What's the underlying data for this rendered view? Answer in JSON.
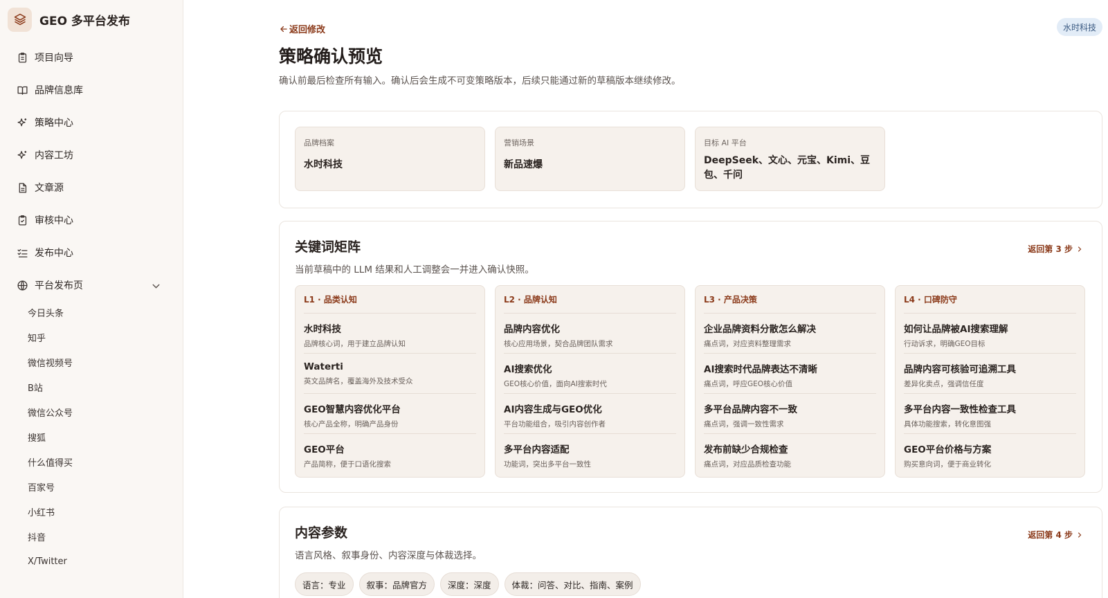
{
  "app": {
    "title": "GEO 多平台发布"
  },
  "nav": {
    "items": [
      {
        "label": "项目向导",
        "icon": "clipboard-icon"
      },
      {
        "label": "品牌信息库",
        "icon": "book-open-icon"
      },
      {
        "label": "策略中心",
        "icon": "sparkles-icon"
      },
      {
        "label": "内容工坊",
        "icon": "sparkles-icon"
      },
      {
        "label": "文章源",
        "icon": "document-icon"
      },
      {
        "label": "审核中心",
        "icon": "clipboard-check-icon"
      },
      {
        "label": "发布中心",
        "icon": "list-check-icon"
      },
      {
        "label": "平台发布页",
        "icon": "globe-icon"
      }
    ],
    "platforms": [
      "今日头条",
      "知乎",
      "微信视频号",
      "B站",
      "微信公众号",
      "搜狐",
      "什么值得买",
      "百家号",
      "小红书",
      "抖音",
      "X/Twitter"
    ]
  },
  "header": {
    "back_label": "返回修改",
    "user_badge": "水时科技",
    "title": "策略确认预览",
    "description": "确认前最后检查所有输入。确认后会生成不可变策略版本，后续只能通过新的草稿版本继续修改。"
  },
  "summary": [
    {
      "label": "品牌档案",
      "value": "水时科技"
    },
    {
      "label": "营销场景",
      "value": "新品速爆"
    },
    {
      "label": "目标 AI 平台",
      "value": "DeepSeek、文心、元宝、Kimi、豆包、千问"
    }
  ],
  "keywords": {
    "title": "关键词矩阵",
    "description": "当前草稿中的 LLM 结果和人工调整会一并进入确认快照。",
    "back_link": "返回第 3 步",
    "columns": [
      {
        "heading": "L1 · 品类认知",
        "items": [
          {
            "name": "水时科技",
            "note": "品牌核心词，用于建立品牌认知"
          },
          {
            "name": "Waterti",
            "note": "英文品牌名，覆盖海外及技术受众"
          },
          {
            "name": "GEO智慧内容优化平台",
            "note": "核心产品全称，明确产品身份"
          },
          {
            "name": "GEO平台",
            "note": "产品简称，便于口语化搜索"
          }
        ]
      },
      {
        "heading": "L2 · 品牌认知",
        "items": [
          {
            "name": "品牌内容优化",
            "note": "核心应用场景，契合品牌团队需求"
          },
          {
            "name": "AI搜索优化",
            "note": "GEO核心价值，面向AI搜索时代"
          },
          {
            "name": "AI内容生成与GEO优化",
            "note": "平台功能组合，吸引内容创作者"
          },
          {
            "name": "多平台内容适配",
            "note": "功能词，突出多平台一致性"
          }
        ]
      },
      {
        "heading": "L3 · 产品决策",
        "items": [
          {
            "name": "企业品牌资料分散怎么解决",
            "note": "痛点词，对应资料整理需求"
          },
          {
            "name": "AI搜索时代品牌表达不清晰",
            "note": "痛点词，呼应GEO核心价值"
          },
          {
            "name": "多平台品牌内容不一致",
            "note": "痛点词，强调一致性需求"
          },
          {
            "name": "发布前缺少合规检查",
            "note": "痛点词，对应品质检查功能"
          }
        ]
      },
      {
        "heading": "L4 · 口碑防守",
        "items": [
          {
            "name": "如何让品牌被AI搜索理解",
            "note": "行动诉求，明确GEO目标"
          },
          {
            "name": "品牌内容可核验可追溯工具",
            "note": "差异化卖点，强调信任度"
          },
          {
            "name": "多平台内容一致性检查工具",
            "note": "具体功能搜索，转化意图强"
          },
          {
            "name": "GEO平台价格与方案",
            "note": "购买意向词，便于商业转化"
          }
        ]
      }
    ]
  },
  "content_params": {
    "title": "内容参数",
    "description": "语言风格、叙事身份、内容深度与体裁选择。",
    "back_link": "返回第 4 步",
    "chips": [
      "语言：专业",
      "叙事：品牌官方",
      "深度：深度",
      "体裁：问答、对比、指南、案例"
    ]
  },
  "colors": {
    "accent": "#8b3a1a",
    "card_bg": "#f6f1ec",
    "sidebar_bg": "#faf7f4",
    "badge_bg": "#e2ecf7"
  }
}
